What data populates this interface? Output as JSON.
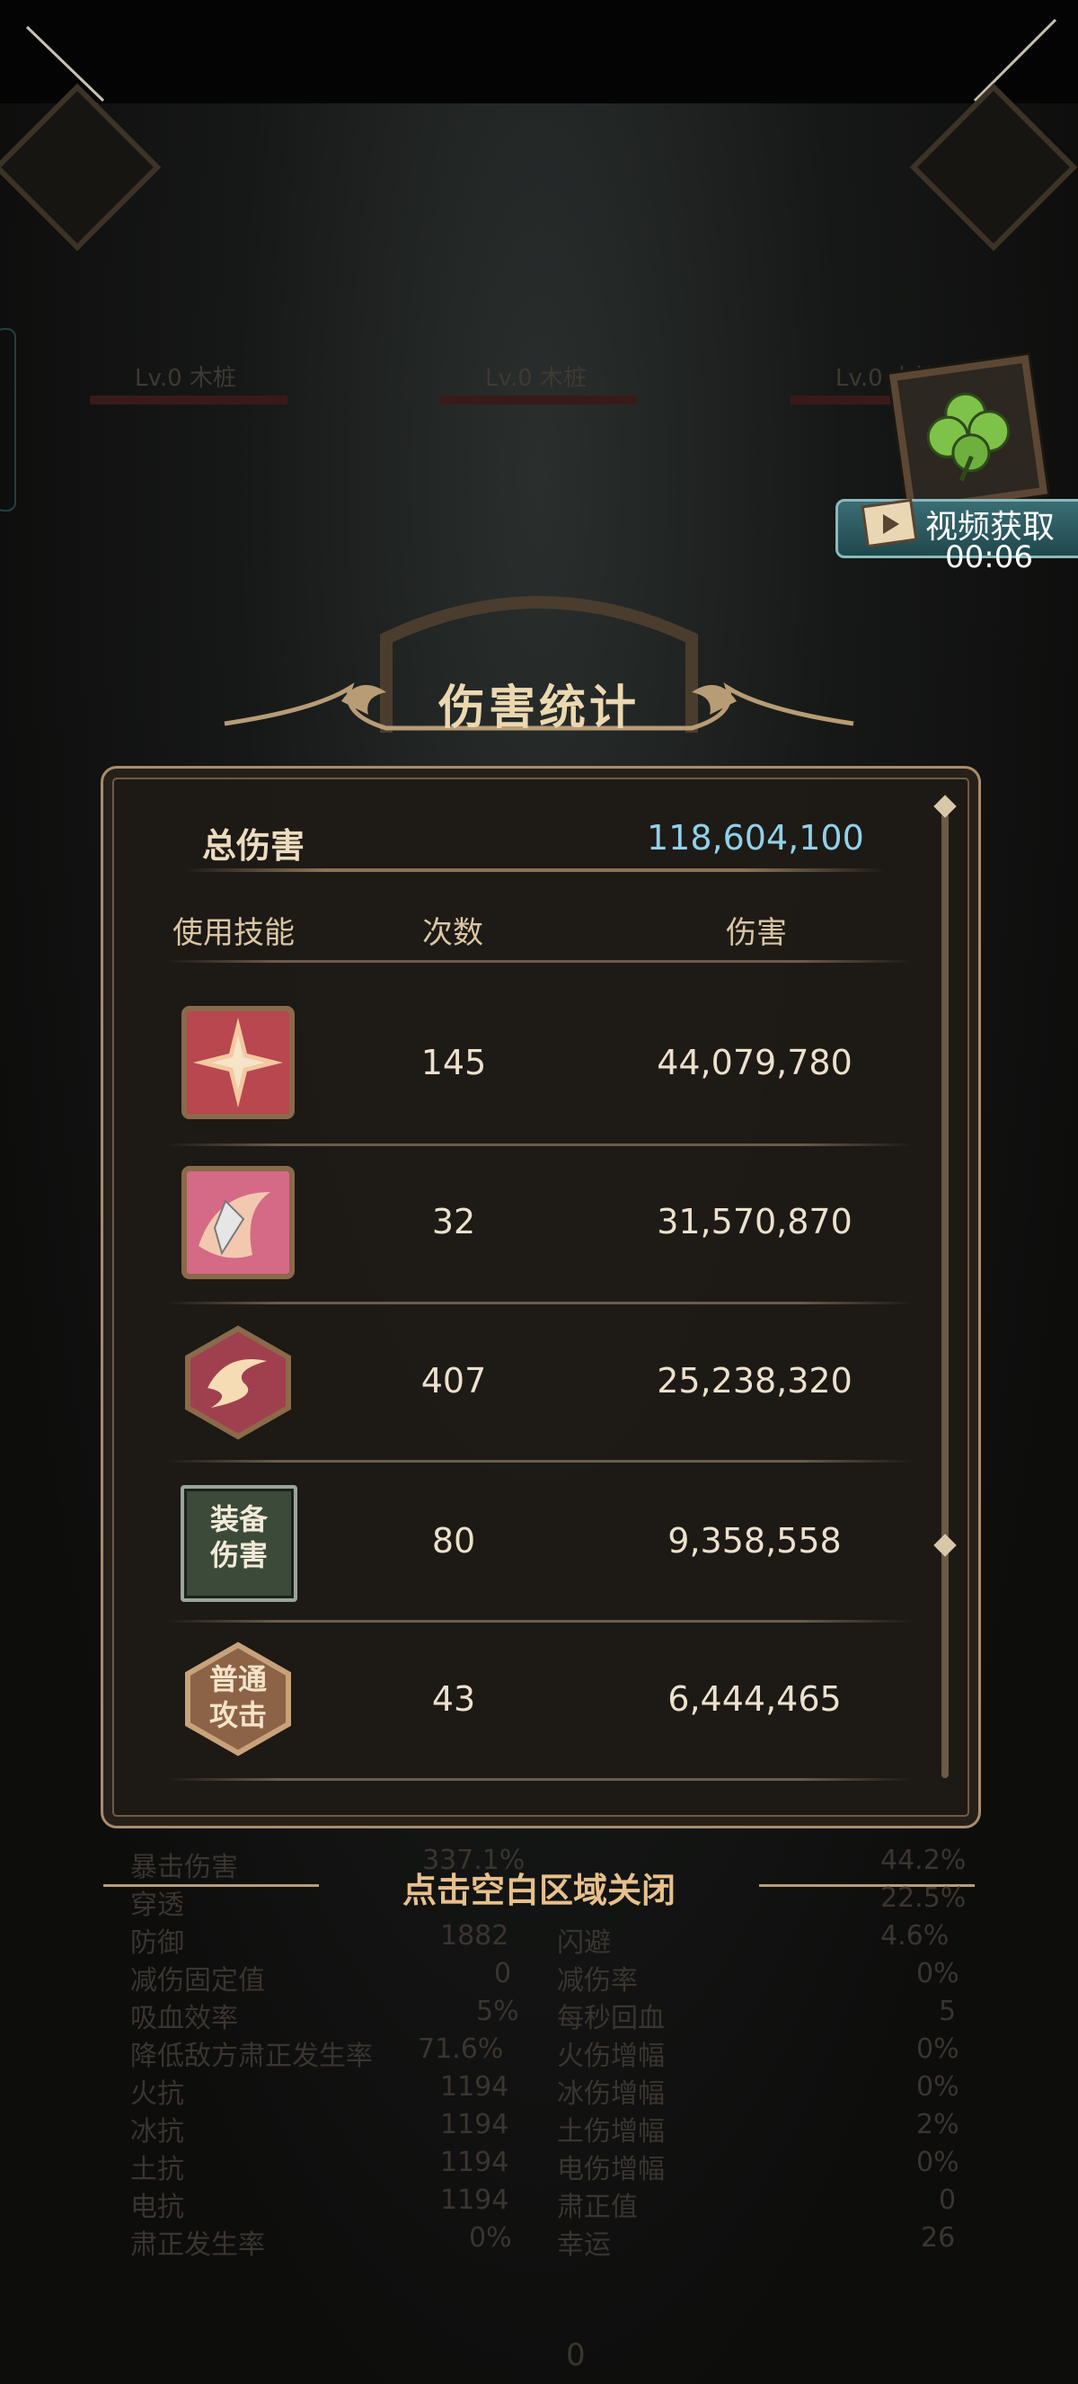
{
  "scene": {
    "enemy_labels": [
      "Lv.0 木桩",
      "Lv.0 木桩",
      "Lv.0 木桩"
    ],
    "bottom_counter": "0"
  },
  "reward": {
    "video_label": "视频获取",
    "timer": "00:06"
  },
  "title": "伤害统计",
  "total": {
    "label": "总伤害",
    "value": "118,604,100"
  },
  "headers": {
    "skill": "使用技能",
    "count": "次数",
    "damage": "伤害"
  },
  "rows": [
    {
      "icon": "crystal-burst-icon",
      "count": "145",
      "damage": "44,079,780"
    },
    {
      "icon": "sword-swirl-icon",
      "count": "32",
      "damage": "31,570,870"
    },
    {
      "icon": "whirlwind-icon",
      "count": "407",
      "damage": "25,238,320"
    },
    {
      "icon": "equipment-damage-icon",
      "label": "装备\n伤害",
      "label_line1": "装备",
      "label_line2": "伤害",
      "count": "80",
      "damage": "9,358,558"
    },
    {
      "icon": "normal-attack-icon",
      "label_line1": "普通",
      "label_line2": "攻击",
      "count": "43",
      "damage": "6,444,465"
    }
  ],
  "close_hint": "点击空白区域关闭",
  "background_stats": {
    "left": [
      {
        "label": "暴击伤害",
        "value": "337.1%"
      },
      {
        "label": "穿透",
        "value": ""
      },
      {
        "label": "防御",
        "value": "1882"
      },
      {
        "label": "减伤固定值",
        "value": "0"
      },
      {
        "label": "吸血效率",
        "value": "5%"
      },
      {
        "label": "降低敌方肃正发生率",
        "value": "71.6%"
      },
      {
        "label": "火抗",
        "value": "1194"
      },
      {
        "label": "冰抗",
        "value": "1194"
      },
      {
        "label": "土抗",
        "value": "1194"
      },
      {
        "label": "电抗",
        "value": "1194"
      },
      {
        "label": "肃正发生率",
        "value": "0%"
      }
    ],
    "right": [
      {
        "label": "",
        "value": "44.2%"
      },
      {
        "label": "",
        "value": "22.5%"
      },
      {
        "label": "闪避",
        "value": "4.6%"
      },
      {
        "label": "减伤率",
        "value": "0%"
      },
      {
        "label": "每秒回血",
        "value": "5"
      },
      {
        "label": "火伤增幅",
        "value": "0%"
      },
      {
        "label": "冰伤增幅",
        "value": "0%"
      },
      {
        "label": "土伤增幅",
        "value": "2%"
      },
      {
        "label": "电伤增幅",
        "value": "0%"
      },
      {
        "label": "肃正值",
        "value": "0"
      },
      {
        "label": "幸运",
        "value": "26"
      }
    ]
  },
  "colors": {
    "total_value": "#8fd2ea",
    "close_hint": "#e7c08c",
    "panel_border": "#a98c6d"
  }
}
